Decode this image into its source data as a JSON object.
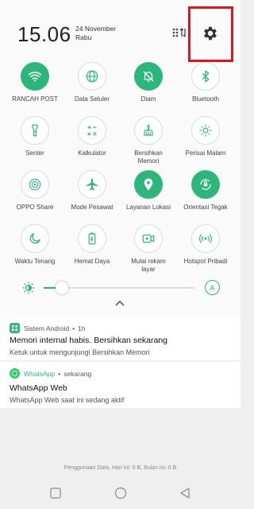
{
  "header": {
    "time": "15.06",
    "date_line1": "24 November",
    "date_line2": "Rabu"
  },
  "tiles": [
    {
      "label": "RANCAH POST",
      "state": "on",
      "icon": "wifi-icon"
    },
    {
      "label": "Data Seluler",
      "state": "off",
      "icon": "globe-icon"
    },
    {
      "label": "Diam",
      "state": "on",
      "icon": "bell-mute-icon"
    },
    {
      "label": "Bluetooth",
      "state": "off",
      "icon": "bluetooth-icon"
    },
    {
      "label": "Senter",
      "state": "off",
      "icon": "flashlight-icon"
    },
    {
      "label": "Kalkulator",
      "state": "off",
      "icon": "calculator-icon"
    },
    {
      "label": "Bersihkan\nMemori",
      "state": "off",
      "icon": "broom-icon"
    },
    {
      "label": "Perisai Malam",
      "state": "off",
      "icon": "night-shield-icon"
    },
    {
      "label": "OPPO Share",
      "state": "off",
      "icon": "share-icon"
    },
    {
      "label": "Mode Pesawat",
      "state": "off",
      "icon": "airplane-icon"
    },
    {
      "label": "Layanan Lokasi",
      "state": "on",
      "icon": "location-icon"
    },
    {
      "label": "Orientasi Tegak",
      "state": "on",
      "icon": "rotation-lock-icon"
    },
    {
      "label": "Waktu Tenang",
      "state": "off",
      "icon": "moon-icon"
    },
    {
      "label": "Hemat Daya",
      "state": "off",
      "icon": "battery-icon"
    },
    {
      "label": "Mulai rekam\nlayar",
      "state": "off",
      "icon": "screen-record-icon"
    },
    {
      "label": "Hotspot Pribadi",
      "state": "off",
      "icon": "hotspot-icon"
    }
  ],
  "brightness": {
    "auto_label": "A",
    "level_percent": 12
  },
  "notifications": [
    {
      "app": "Sistem Android",
      "time": "1h",
      "title": "Memori internal habis. Bersihkan sekarang",
      "body": "Ketuk untuk mengunjungi Bersihkan Memori",
      "app_color": "#2db67c"
    },
    {
      "app": "WhatsApp",
      "time": "sekarang",
      "title": "WhatsApp Web",
      "body": "WhatsApp Web saat ini sedang aktif",
      "app_color": "#25d366"
    }
  ],
  "footer": {
    "data_usage": "Penggunaan Data, Hari ini: 0 B, Bulan ini: 0 B"
  },
  "colors": {
    "accent": "#2db67c",
    "highlight": "#e0141c"
  }
}
